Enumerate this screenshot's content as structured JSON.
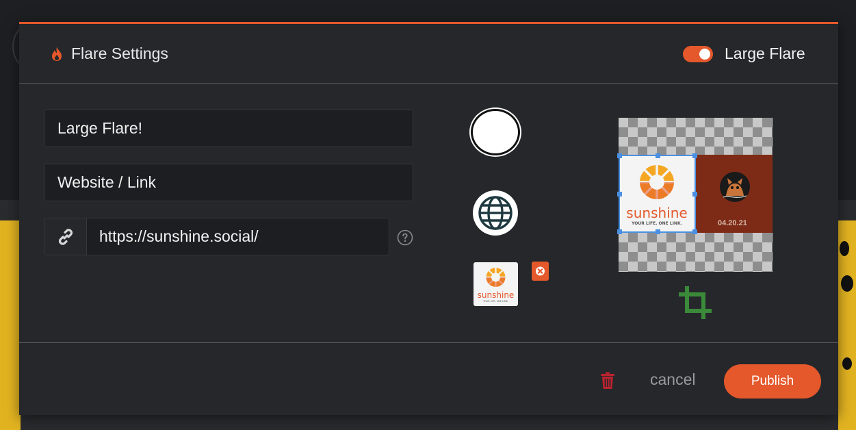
{
  "header": {
    "title": "Flare Settings",
    "toggle_label": "Large Flare",
    "toggle_on": true
  },
  "form": {
    "title_value": "Large Flare!",
    "type_value": "Website / Link",
    "url_value": "https://sunshine.social/"
  },
  "thumbnail": {
    "brand": "sunshine",
    "tagline": "YOUR LIFE. ONE LINK."
  },
  "preview": {
    "brand": "sunshine",
    "tagline": "YOUR LIFE. ONE LINK.",
    "date": "04.20.21"
  },
  "footer": {
    "cancel_label": "cancel",
    "publish_label": "Publish"
  },
  "colors": {
    "accent": "#e4582b",
    "selection": "#4a90e2",
    "crop": "#3a8a3a"
  },
  "icons": [
    "flame-icon",
    "link-icon",
    "help-icon",
    "globe-icon",
    "close-icon",
    "crop-icon",
    "trash-icon"
  ]
}
